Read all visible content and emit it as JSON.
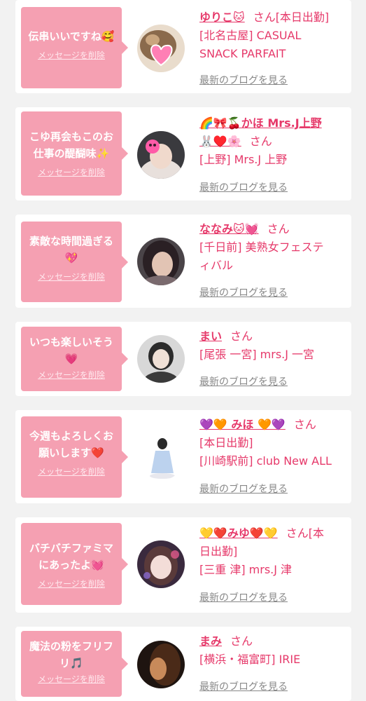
{
  "cards": [
    {
      "message": "伝串いいですね🥰",
      "delete_label": "メッセージを削除",
      "avatar_icon": "cat-with-pink-heart-photo",
      "name": "ゆりこ🐱",
      "san": "さん[本日出勤]",
      "shop_lines": [
        "[北名古屋] CASUAL",
        "SNACK PARFAIT"
      ],
      "blog_label": "最新のブログを見る"
    },
    {
      "message": "こゆ再会もこのお仕事の醍醐味✨",
      "delete_label": "メッセージを削除",
      "avatar_icon": "woman-with-pumpkin-face-photo",
      "name": "🌈🎀🍒かほ Mrs.J上野",
      "name_line2": "🐰♥️🌸",
      "san": "さん",
      "shop_lines": [
        "[上野] Mrs.J 上野"
      ],
      "blog_label": "最新のブログを見る"
    },
    {
      "message": "素敵な時間過ぎる💖",
      "delete_label": "メッセージを削除",
      "avatar_icon": "woman-portrait-photo",
      "name": "ななみ🐱💓",
      "san": "さん",
      "shop_lines": [
        "[千日前] 美熟女フェステ",
        "ィバル"
      ],
      "blog_label": "最新のブログを見る"
    },
    {
      "message": "いつも楽しいそう💗",
      "delete_label": "メッセージを削除",
      "avatar_icon": "woman-portrait-photo",
      "name": "まい",
      "san": "さん",
      "shop_lines": [
        "[尾張 一宮] mrs.J 一宮"
      ],
      "blog_label": "最新のブログを見る"
    },
    {
      "message": "今週もよろしくお願いします❤️",
      "delete_label": "メッセージを削除",
      "avatar_icon": "woman-in-blue-dress-photo",
      "name": "💜🧡 みほ 🧡💜",
      "san": "さん",
      "shop_lines": [
        "[本日出勤]",
        "[川崎駅前] club New ALL"
      ],
      "blog_label": "最新のブログを見る"
    },
    {
      "message": "バチバチファミマにあったよ💓",
      "delete_label": "メッセージを削除",
      "avatar_icon": "woman-selfie-photo",
      "name": "💛❤️みゆ❤️💛",
      "san": "さん[本",
      "name_line2": "日出勤]",
      "shop_lines": [
        "[三重 津] mrs.J 津"
      ],
      "blog_label": "最新のブログを見る"
    },
    {
      "message": "魔法の粉をフリフリ🎵",
      "delete_label": "メッセージを削除",
      "avatar_icon": "woman-dark-hair-photo",
      "name": "まみ",
      "san": "さん",
      "shop_lines": [
        "[横浜・福富町] IRIE"
      ],
      "blog_label": "最新のブログを見る"
    }
  ]
}
